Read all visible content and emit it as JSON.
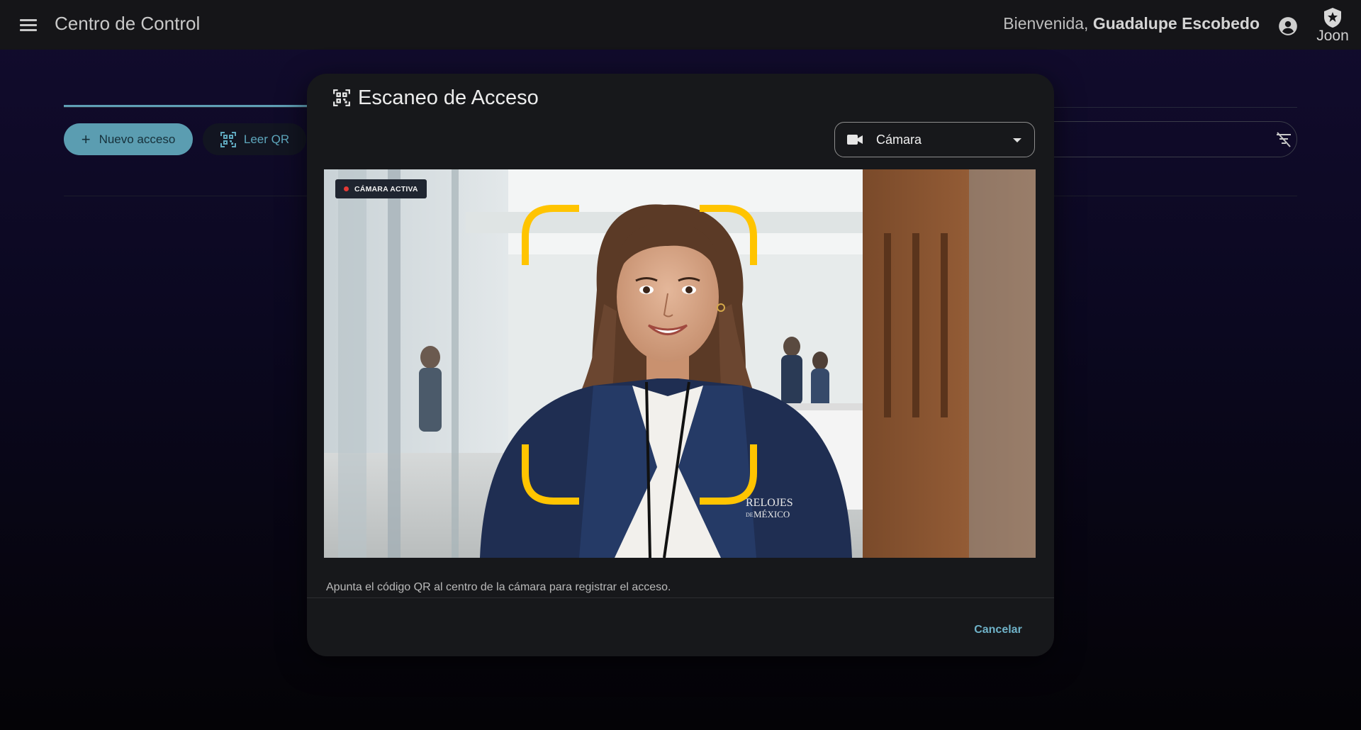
{
  "header": {
    "app_title": "Centro de Control",
    "welcome_prefix": "Bienvenida,",
    "user_name": "Guadalupe Escobedo",
    "brand": "Joon"
  },
  "page": {
    "new_access_label": "Nuevo acceso",
    "read_qr_label": "Leer QR"
  },
  "dialog": {
    "title": "Escaneo de Acceso",
    "source_select": {
      "selected": "Cámara"
    },
    "camera": {
      "status_badge": "CÁMARA ACTIVA",
      "badge_dot_color": "#e53935",
      "scan_frame_color": "#ffc400",
      "logo_text_line1": "RELOJES",
      "logo_text_line2_small": "DE",
      "logo_text_line2": "MÉXICO"
    },
    "hint": "Apunta el código QR al centro de la cámara para registrar el acceso.",
    "cancel_label": "Cancelar"
  },
  "colors": {
    "accent": "#5b9db1",
    "link": "#6fb2c8",
    "dialog_bg": "#17181b",
    "topbar_bg": "#151518"
  },
  "icons": {
    "menu": "menu-icon",
    "account": "account-circle-icon",
    "brand": "shield-logo-icon",
    "add": "plus-icon",
    "qr": "qr-scan-icon",
    "filter": "filter-off-icon",
    "video": "videocam-icon",
    "dropdown": "caret-down-icon"
  }
}
